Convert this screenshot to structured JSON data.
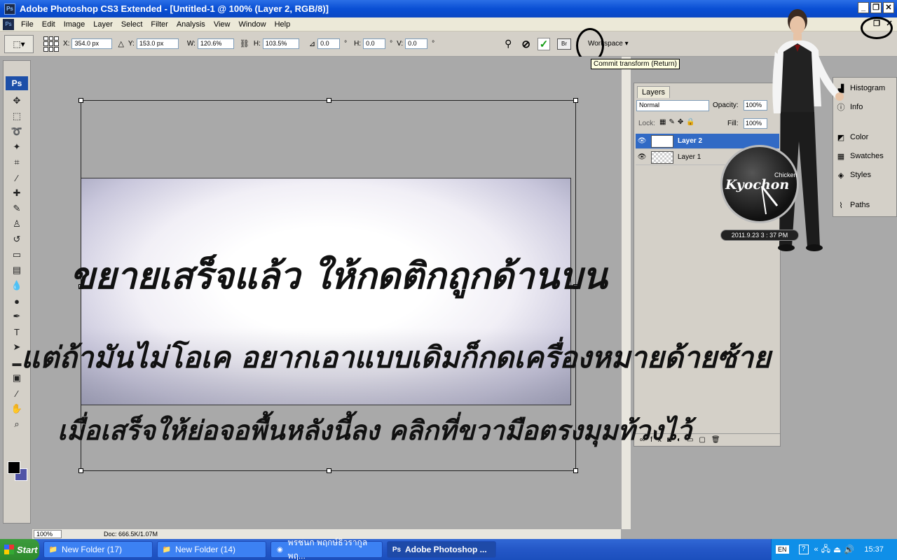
{
  "window": {
    "title": "Adobe Photoshop CS3 Extended - [Untitled-1 @ 100% (Layer 2, RGB/8)]",
    "app_icon": "Ps"
  },
  "menu": [
    "File",
    "Edit",
    "Image",
    "Layer",
    "Select",
    "Filter",
    "Analysis",
    "View",
    "Window",
    "Help"
  ],
  "options": {
    "x_label": "X:",
    "x_value": "354.0 px",
    "y_label": "Y:",
    "y_value": "153.0 px",
    "w_label": "W:",
    "w_value": "120.6%",
    "h_label": "H:",
    "h_value": "103.5%",
    "rot_value": "0.0",
    "hskew_label": "H:",
    "hskew_value": "0.0",
    "vskew_label": "V:",
    "vskew_value": "0.0",
    "workspace_label": "Workspace ▾",
    "tooltip": "Commit transform (Return)"
  },
  "toolbox": {
    "badge": "Ps"
  },
  "layers": {
    "tab": "Layers",
    "blend_mode": "Normal",
    "opacity_label": "Opacity:",
    "opacity_value": "100%",
    "lock_label": "Lock:",
    "fill_label": "Fill:",
    "fill_value": "100%",
    "items": [
      {
        "name": "Layer 2",
        "selected": true
      },
      {
        "name": "Layer 1",
        "selected": false
      }
    ]
  },
  "dock": [
    "Histogram",
    "Info",
    "Color",
    "Swatches",
    "Styles",
    "Paths"
  ],
  "status": {
    "zoom": "100%",
    "doc": "Doc: 666.5K/1.07M"
  },
  "clock_widget": {
    "brand_small": "Chicken",
    "brand": "Kyochon",
    "datetime": "2011.9.23   3 : 37 PM"
  },
  "overlay_text": {
    "line1": "ขยายเสร็จแล้ว ให้กดติกถูกด้านบน",
    "line2": "แต่ถ้ามันไม่โอเค อยากเอาแบบเดิมก็กดเครื่องหมายด้ายซ้าย",
    "line3": "เมื่อเสร็จให้ย่อจอพื้นหลังนี้ลง คลิกที่ขวามือตรงมุมท้วงไว้"
  },
  "taskbar": {
    "start": "Start",
    "tasks": [
      "New Folder (17)",
      "New Folder (14)",
      "พรชนก พฤกษ์ธิวรากูล พฤ...",
      "Adobe Photoshop ..."
    ],
    "lang": "EN",
    "time": "15:37"
  }
}
